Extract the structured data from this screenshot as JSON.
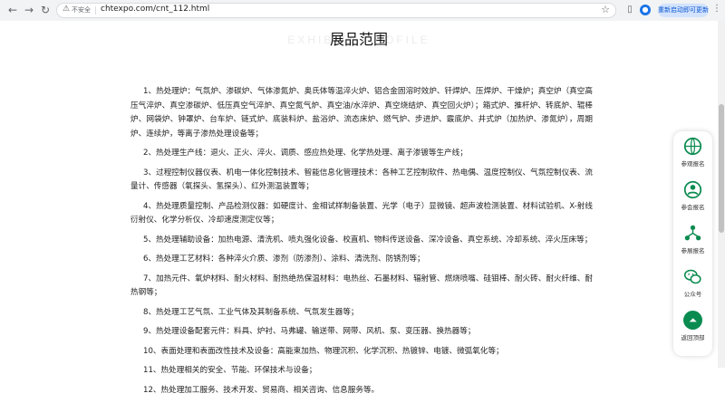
{
  "browser": {
    "back_icon": "back-arrow-icon",
    "forward_icon": "forward-arrow-icon",
    "reload_icon": "reload-icon",
    "security_label": "不安全",
    "url": "chtexpo.com/cnt_112.html",
    "restart_label": "重新启动即可更新",
    "accent_color": "#1a73e8"
  },
  "page": {
    "heading_en": "EXHIBITS PROFILE",
    "heading_cn": "展品范围",
    "items": [
      "1、热处理炉：气氛炉、渗碳炉、气体渗氮炉、奥氏体等温淬火炉、铝合金固溶时效炉、钎焊炉、压焊炉、干燥炉；真空炉（真空高压气淬炉、真空渗碳炉、低压真空气淬炉、真空氮气炉、真空油/水淬炉、真空烧结炉、真空回火炉）；箱式炉、推杆炉、转底炉、辊棒炉、网袋炉、钟罩炉、台车炉、链式炉、底装料炉、盐浴炉、流态床炉、燃气炉、步进炉、霰底炉、井式炉（加热炉、渗氮炉），周期炉、连续炉，等离子渗热处理设备等；",
      "2、热处理生产线：退火、正火、淬火、调质、感应热处理、化学热处理、离子渗镀等生产线；",
      "3、过程控制仪器仪表、机电一体化控制技术、智能信息化管理技术：各种工艺控制软件、热电偶、温度控制仪、气氛控制仪表、流量计、传感器（氧探头、氢探头）、红外测温装置等；",
      "4、热处理质量控制、产品检测仪器：如硬度计、金相试样制备装置、光学（电子）显微镜、超声波检测装置、材料试验机、X-射线衍射仪、化学分析仪、冷却速度测定仪等；",
      "5、热处理辅助设备：加热电源、清洗机、喷丸强化设备、校直机、物料传送设备、深冷设备、真空系统、冷却系统、淬火压床等；",
      "6、热处理工艺材料：各种淬火介质、渗剂（防渗剂）、涂料、清洗剂、防锈剂等；",
      "7、加热元件、氧炉材料、耐火材料、耐热绝热保温材料：电热丝、石墨材料、辐射管、燃烧喷嘴、硅钼棒、耐火砖、耐火纤维、耐热钢等；",
      "8、热处理工艺气氛、工业气体及其制备系统、气氛发生器等；",
      "9、热处理设备配套元件：料具、炉衬、马弗罐、输送带、网带、风机、泵、变压器、换热器等；",
      "10、表面处理和表面改性技术及设备：高能束加热、物理沉积、化学沉积、热镀锌、电镀、微弧氧化等；",
      "11、热处理相关的安全、节能、环保技术与设备；",
      "12、热处理加工服务、技术开发、贸易商、相关咨询、信息服务等。"
    ]
  },
  "side": {
    "items": [
      {
        "label": "参观报名",
        "icon": "globe-register-icon"
      },
      {
        "label": "参会报名",
        "icon": "person-register-icon"
      },
      {
        "label": "参展报名",
        "icon": "network-register-icon"
      },
      {
        "label": "公众号",
        "icon": "wechat-icon"
      },
      {
        "label": "返回顶部",
        "icon": "back-to-top-icon"
      }
    ],
    "brand_color": "#0a8b4f"
  }
}
